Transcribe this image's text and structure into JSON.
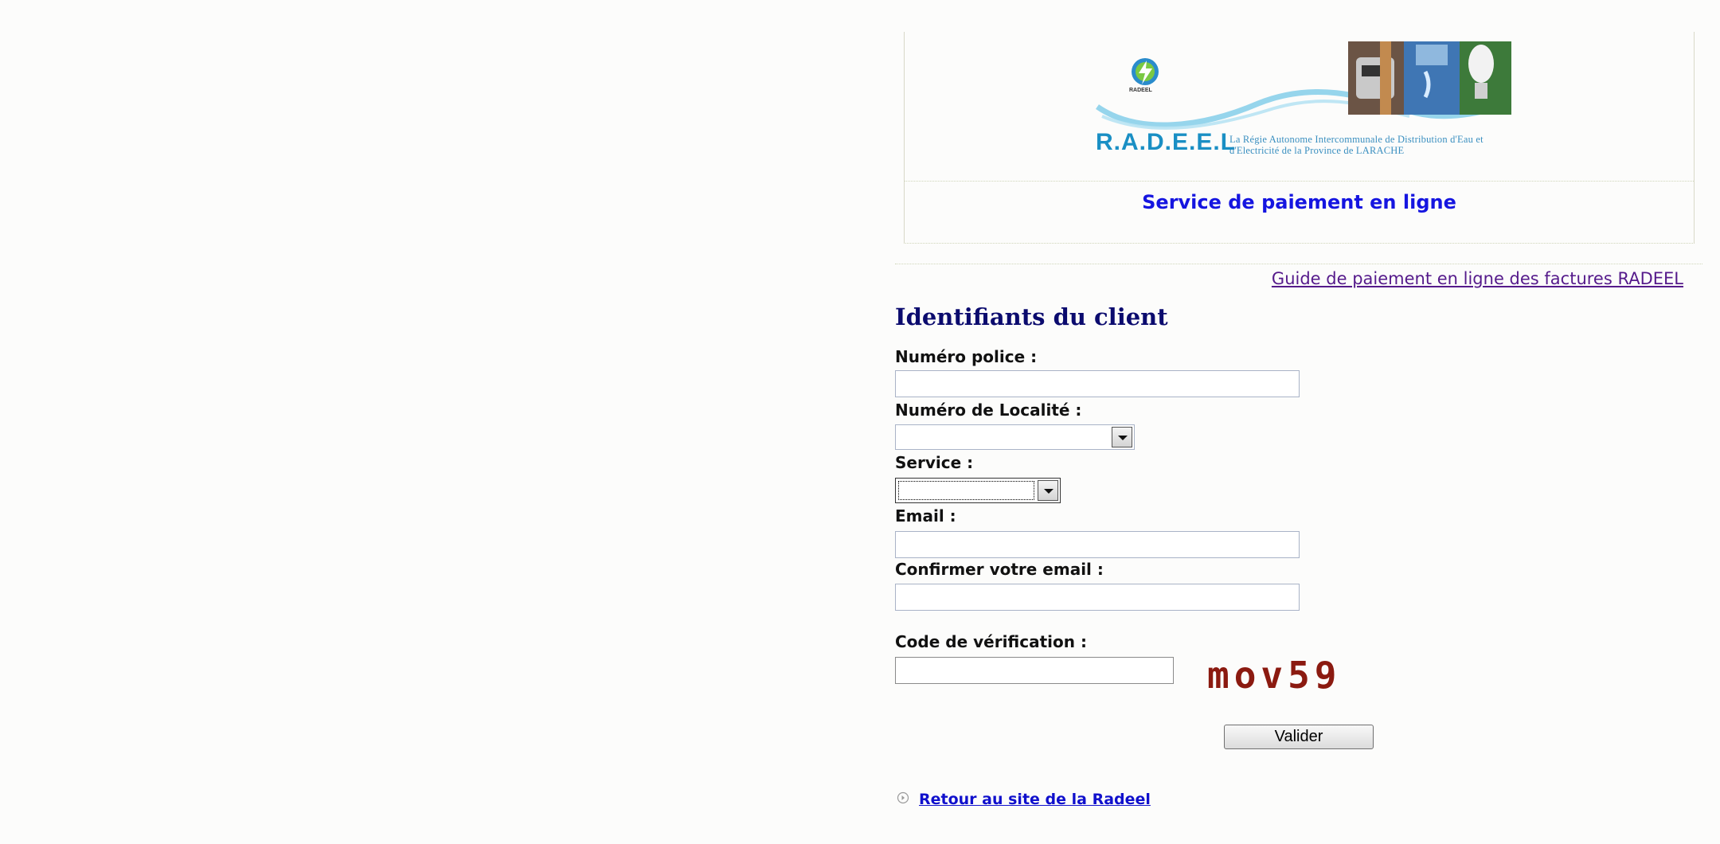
{
  "header": {
    "logo_wordmark": "R.A.D.E.E.L",
    "logo_tagline": "La Régie Autonome Intercommunale de Distribution d'Eau et d'Electricité de la Province de LARACHE",
    "logo_small_text": "RADEEL",
    "service_title": "Service de paiement en ligne"
  },
  "guide_link": "Guide de paiement en ligne des factures RADEEL",
  "form": {
    "section_title": "Identifiants du client",
    "police_label": "Numéro police :",
    "police_value": "",
    "localite_label": "Numéro de Localité :",
    "localite_value": "",
    "service_label": "Service :",
    "service_value": "",
    "email_label": "Email :",
    "email_value": "",
    "confirm_email_label": "Confirmer votre email :",
    "confirm_email_value": "",
    "code_label": "Code de vérification :",
    "code_value": "",
    "captcha_text": "mov59",
    "submit_label": "Valider"
  },
  "back_link": "Retour au site de la Radeel",
  "colors": {
    "wordmark": "#1a8fc4",
    "service_title": "#1515e0",
    "section_title": "#0b0b6e",
    "captcha": "#8b1a10"
  }
}
